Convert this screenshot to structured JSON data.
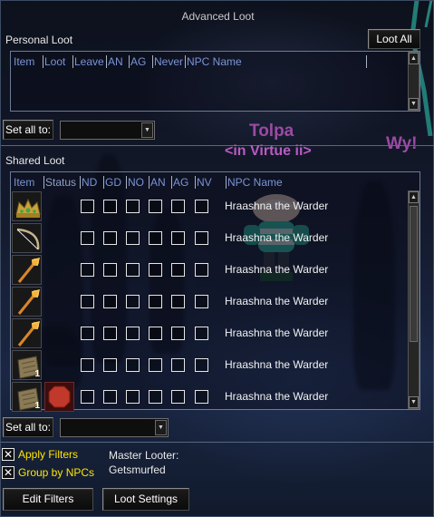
{
  "window": {
    "title": "Advanced Loot"
  },
  "personal_loot": {
    "section_label": "Personal Loot",
    "loot_all_label": "Loot All",
    "columns": [
      "Item",
      "Loot",
      "Leave",
      "AN",
      "AG",
      "Never",
      "NPC Name"
    ],
    "set_all_label": "Set all to:",
    "set_all_value": ""
  },
  "shared_loot": {
    "section_label": "Shared Loot",
    "columns": [
      "Item",
      "Status",
      "ND",
      "GD",
      "NO",
      "AN",
      "AG",
      "NV",
      "NPC Name"
    ],
    "rows": [
      {
        "icon": "crown-icon",
        "quantity": "",
        "status": "",
        "npc": "Hraashna the Warder"
      },
      {
        "icon": "bow-icon",
        "quantity": "",
        "status": "",
        "npc": "Hraashna the Warder"
      },
      {
        "icon": "staff-icon",
        "quantity": "",
        "status": "",
        "npc": "Hraashna the Warder"
      },
      {
        "icon": "staff-icon",
        "quantity": "",
        "status": "",
        "npc": "Hraashna the Warder"
      },
      {
        "icon": "staff-icon",
        "quantity": "",
        "status": "",
        "npc": "Hraashna the Warder"
      },
      {
        "icon": "rune-bag-icon",
        "quantity": "1",
        "status": "",
        "npc": "Hraashna the Warder"
      },
      {
        "icon": "rune-bag-icon",
        "quantity": "1",
        "status": "stop-sign-icon",
        "npc": "Hraashna the Warder"
      }
    ],
    "set_all_label": "Set all to:",
    "set_all_value": ""
  },
  "footer": {
    "apply_filters_label": "Apply Filters",
    "apply_filters_checked": true,
    "group_by_npcs_label": "Group by NPCs",
    "group_by_npcs_checked": true,
    "master_looter_label": "Master Looter:",
    "master_looter_name": "Getsmurfed",
    "edit_filters_label": "Edit Filters",
    "loot_settings_label": "Loot Settings"
  },
  "world_overlay": {
    "character_name": "Tolpa",
    "guild_tag": "<in Virtue ii>",
    "other_name_fragment": "Wy!"
  },
  "colors": {
    "header_blue": "#7a94d8",
    "checkbox_label_yellow": "#ffe600",
    "nameplate_purple": "#9a4aa5",
    "status_red": "#c0392b"
  }
}
